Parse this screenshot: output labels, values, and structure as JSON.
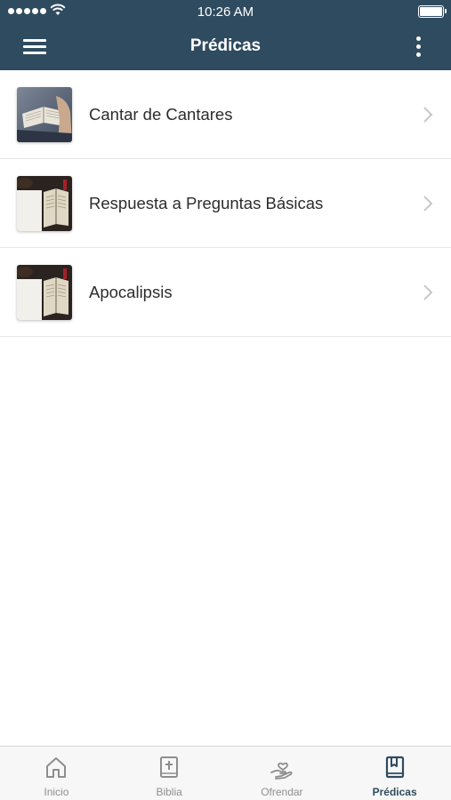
{
  "status_bar": {
    "time": "10:26 AM"
  },
  "nav": {
    "title": "Prédicas"
  },
  "sermons": [
    {
      "title": "Cantar de Cantares",
      "thumbnail": "open-bible-hand-photo"
    },
    {
      "title": "Respuesta a Preguntas Básicas",
      "thumbnail": "bible-on-table-photo"
    },
    {
      "title": "Apocalipsis",
      "thumbnail": "bible-on-table-photo"
    }
  ],
  "tabs": [
    {
      "label": "Inicio",
      "icon": "home-icon",
      "active": false
    },
    {
      "label": "Biblia",
      "icon": "bible-cross-icon",
      "active": false
    },
    {
      "label": "Ofrendar",
      "icon": "hand-heart-icon",
      "active": false
    },
    {
      "label": "Prédicas",
      "icon": "bookmark-book-icon",
      "active": true
    }
  ],
  "colors": {
    "header": "#2f4b5f",
    "active_tab": "#2f4b5f",
    "inactive_tab": "#8e8e8e"
  }
}
